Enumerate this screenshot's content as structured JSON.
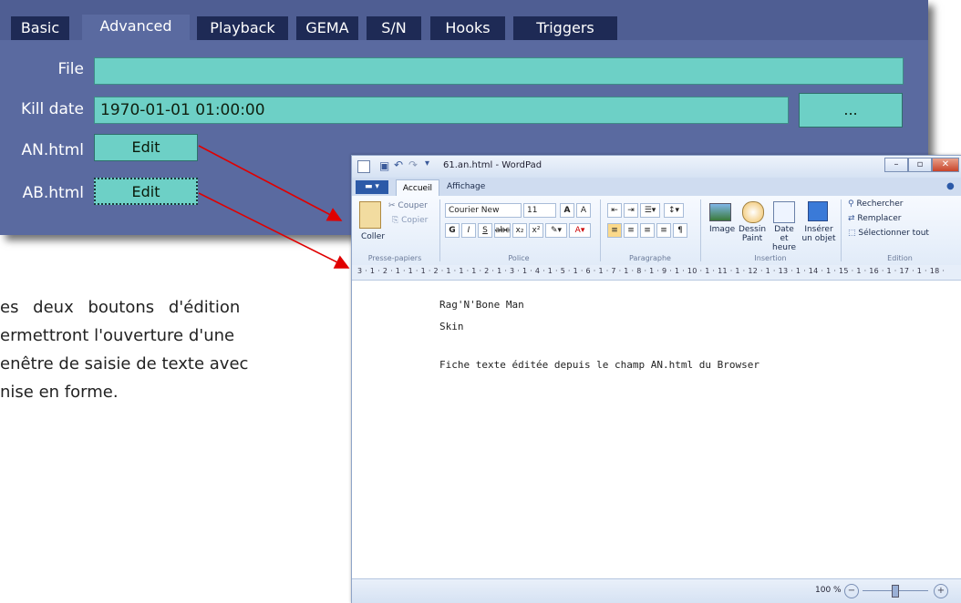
{
  "browser": {
    "tabs": [
      "Basic",
      "Advanced",
      "Playback",
      "GEMA",
      "S/N",
      "Hooks",
      "Triggers"
    ],
    "active_tab": "Advanced",
    "file_label": "File",
    "file_value": "",
    "kill_date_label": "Kill date",
    "kill_date_value": "1970-01-01 01:00:00",
    "browse_button": "...",
    "an_label": "AN.html",
    "an_button": "Edit",
    "ab_label": "AB.html",
    "ab_button": "Edit",
    "colors": {
      "panel": "#5a6aa0",
      "tab": "#1e2a55",
      "field": "#6dd0c6",
      "arrow": "#e00000"
    }
  },
  "caption": {
    "lines": [
      "es deux boutons d'édition",
      "ermettront l'ouverture d'une",
      "enêtre de saisie de texte avec",
      "nise en forme."
    ]
  },
  "wordpad": {
    "title": "61.an.html - WordPad",
    "tabs": {
      "home": "Accueil",
      "view": "Affichage"
    },
    "clipboard": {
      "paste": "Coller",
      "cut": "Couper",
      "copy": "Copier",
      "group": "Presse-papiers"
    },
    "font": {
      "name": "Courier New",
      "size": "11",
      "group": "Police"
    },
    "paragraph": {
      "group": "Paragraphe"
    },
    "insert": {
      "image": "Image",
      "paint": "Dessin Paint",
      "datetime": "Date et heure",
      "object": "Insérer un objet",
      "group": "Insertion"
    },
    "edit": {
      "find": "Rechercher",
      "replace": "Remplacer",
      "select_all": "Sélectionner tout",
      "group": "Edition"
    },
    "ruler": "3 · 1 · 2 · 1 · 1 · 1 · 2 · 1 · 1 · 1 · 2 · 1 · 3 · 1 · 4 · 1 · 5 · 1 · 6 · 1 · 7 · 1 · 8 · 1 · 9 · 1 · 10 · 1 · 11 · 1 · 12 · 1 · 13 · 1 · 14 · 1 · 15 · 1 · 16 · 1 · 17 · 1 · 18 ·",
    "document": [
      "Rag'N'Bone Man",
      "Skin",
      "Fiche texte éditée depuis le champ AN.html du Browser"
    ],
    "zoom": "100 %"
  }
}
